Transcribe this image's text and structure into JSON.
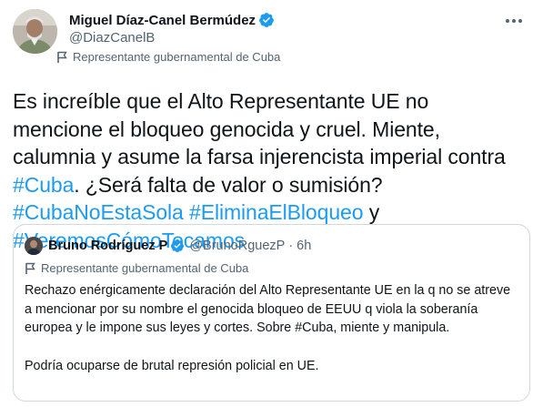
{
  "author": {
    "display_name": "Miguel Díaz-Canel Bermúdez",
    "handle": "@DiazCanelB",
    "label": "Representante gubernamental de Cuba"
  },
  "tweet": {
    "text_1": "Es increíble que el Alto Representante UE no mencione el bloqueo genocida y cruel. Miente, calumnia y asume la farsa injerencista imperial contra ",
    "hashtag_cuba": "#Cuba",
    "text_2": ". ¿Será falta de valor o sumisión? ",
    "hashtag_1": "#CubaNoEstaSola",
    "hashtag_2": "#EliminaElBloqueo",
    "text_3": " y ",
    "hashtag_3": "#VeremosCómoTocamos"
  },
  "quote": {
    "display_name": "Bruno Rodríguez P",
    "handle": "@BrunoRguezP",
    "separator": "·",
    "time": "6h",
    "label": "Representante gubernamental de Cuba",
    "paragraph_1": "Rechazo enérgicamente declaración del Alto Representante UE en la q no se atreve a mencionar por su nombre el genocida bloqueo de EEUU q viola la soberanía europea y le impone sus leyes y cortes. Sobre #Cuba, miente y manipula.",
    "paragraph_2": "Podría ocuparse de brutal represión policial en UE."
  },
  "icons": {
    "verified": "verified-badge-icon",
    "more": "more-options-icon",
    "gov_flag": "flag-icon"
  },
  "colors": {
    "link": "#1d9bf0",
    "secondary_text": "#536471",
    "border": "#cfd9de"
  }
}
